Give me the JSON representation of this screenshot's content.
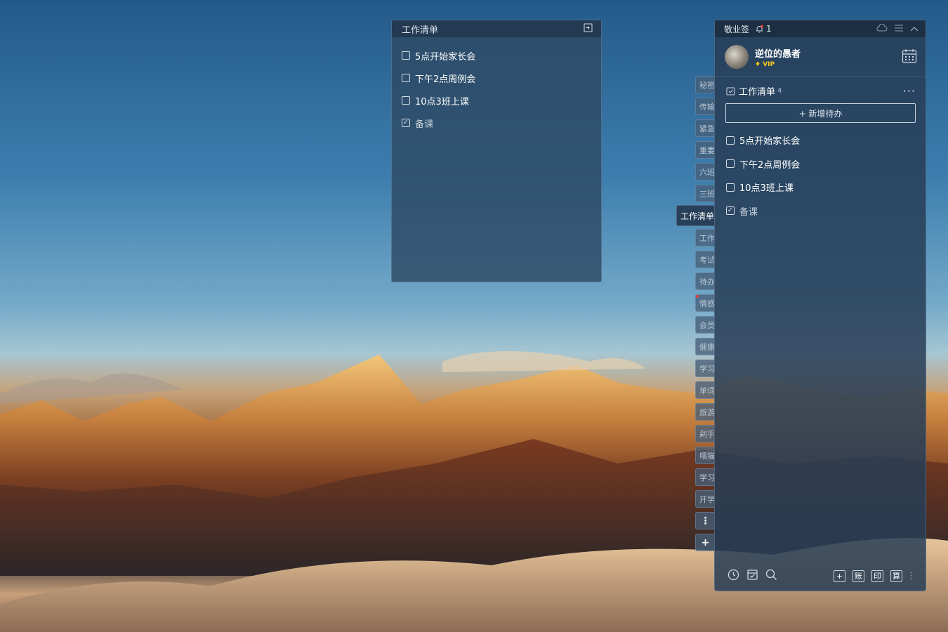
{
  "note": {
    "title": "工作清单",
    "items": [
      {
        "text": "5点开始家长会",
        "done": false
      },
      {
        "text": "下午2点周例会",
        "done": false
      },
      {
        "text": "10点3班上课",
        "done": false
      },
      {
        "text": "备课",
        "done": true
      }
    ],
    "exit_icon": "exit-icon"
  },
  "tabs": {
    "items": [
      "秘密",
      "传输",
      "紧急",
      "重要",
      "六班",
      "三班",
      "工作清单",
      "工作",
      "考试",
      "待办",
      "情感",
      "会员",
      "健康",
      "学习",
      "单词",
      "旅游",
      "剁手",
      "喂猫",
      "学习",
      "开学"
    ],
    "active": "工作清单",
    "more_icon": "more-vertical-icon",
    "add_icon": "plus-icon"
  },
  "panel": {
    "app_name": "敬业签",
    "notification_count": "1",
    "user": {
      "name": "逆位的愚者",
      "vip_label": "VIP"
    },
    "list_title": "工作清单",
    "list_count": "4",
    "add_label": "+ 新增待办",
    "items": [
      {
        "text": "5点开始家长会",
        "done": false
      },
      {
        "text": "下午2点周例会",
        "done": false
      },
      {
        "text": "10点3班上课",
        "done": false
      },
      {
        "text": "备课",
        "done": true
      }
    ],
    "bottom_buttons": [
      "+",
      "账",
      "印",
      "算"
    ]
  },
  "colors": {
    "vip": "#f5c518",
    "notify_dot": "#e0453a"
  }
}
